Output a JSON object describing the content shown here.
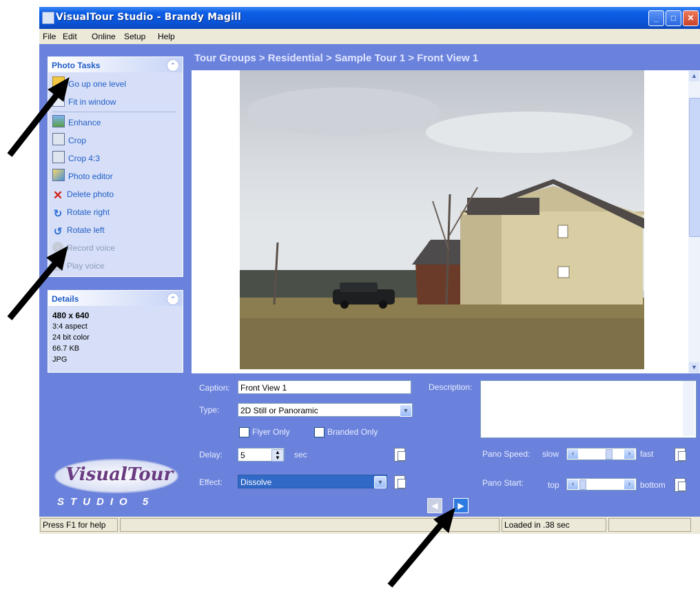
{
  "window": {
    "title": "VisualTour Studio - Brandy Magill"
  },
  "menu": [
    "File",
    "Edit",
    "Online",
    "Setup",
    "Help"
  ],
  "photo_tasks": {
    "title": "Photo Tasks",
    "items": [
      {
        "label": "Go up one level",
        "icon": "up-folder-icon",
        "enabled": true
      },
      {
        "label": "Fit in window",
        "icon": "fit-window-icon",
        "enabled": true
      },
      {
        "label": "Enhance",
        "icon": "enhance-icon",
        "enabled": true
      },
      {
        "label": "Crop",
        "icon": "crop-icon",
        "enabled": true
      },
      {
        "label": "Crop 4:3",
        "icon": "crop-icon",
        "enabled": true
      },
      {
        "label": "Photo editor",
        "icon": "photo-editor-icon",
        "enabled": true
      },
      {
        "label": "Delete photo",
        "icon": "delete-icon",
        "enabled": true
      },
      {
        "label": "Rotate right",
        "icon": "rotate-right-icon",
        "enabled": true
      },
      {
        "label": "Rotate left",
        "icon": "rotate-left-icon",
        "enabled": true
      },
      {
        "label": "Record voice",
        "icon": "microphone-icon",
        "enabled": false
      },
      {
        "label": "Play voice",
        "icon": "speaker-icon",
        "enabled": false
      }
    ]
  },
  "details": {
    "title": "Details",
    "dimensions": "480 x 640",
    "aspect": "3:4 aspect",
    "color": "24 bit color",
    "size": "66.7 KB",
    "format": "JPG"
  },
  "breadcrumb": "Tour Groups > Residential > Sample Tour 1 > Front View 1",
  "form": {
    "caption_label": "Caption:",
    "caption_value": "Front View 1",
    "type_label": "Type:",
    "type_value": "2D Still or Panoramic",
    "flyer_only": "Flyer Only",
    "branded_only": "Branded Only",
    "delay_label": "Delay:",
    "delay_value": "5",
    "delay_unit": "sec",
    "effect_label": "Effect:",
    "effect_value": "Dissolve",
    "description_label": "Description:",
    "pano_speed_label": "Pano Speed:",
    "pano_speed_min": "slow",
    "pano_speed_max": "fast",
    "pano_start_label": "Pano Start:",
    "pano_start_min": "top",
    "pano_start_max": "bottom"
  },
  "logo": {
    "word": "VisualTour",
    "sub": "STUDIO 5"
  },
  "status": {
    "help": "Press F1 for help",
    "loaded": "Loaded in .38 sec"
  },
  "colors": {
    "titlebar": "#0a53d6",
    "panel_bg": "#6b82dc",
    "task_link": "#215dc6"
  }
}
